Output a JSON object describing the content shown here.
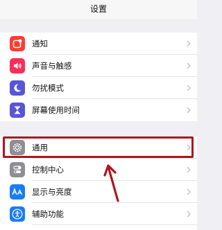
{
  "nav": {
    "title": "设置"
  },
  "group1": [
    {
      "label": "通知",
      "icon": "notifications-icon",
      "color": "#ff3b30"
    },
    {
      "label": "声音与触感",
      "icon": "sound-icon",
      "color": "#ff2d55"
    },
    {
      "label": "勿扰模式",
      "icon": "moon-icon",
      "color": "#5856d6"
    },
    {
      "label": "屏幕使用时间",
      "icon": "hourglass-icon",
      "color": "#5856d6"
    }
  ],
  "group2": [
    {
      "label": "通用",
      "icon": "gear-icon",
      "color": "#8e8e93"
    },
    {
      "label": "控制中心",
      "icon": "toggles-icon",
      "color": "#8e8e93"
    },
    {
      "label": "显示与亮度",
      "icon": "text-size-icon",
      "color": "#1a7cf5"
    },
    {
      "label": "辅助功能",
      "icon": "accessibility-icon",
      "color": "#1a7cf5"
    }
  ],
  "annotation": {
    "highlight_color": "#b0141c",
    "highlighted_item": "通用"
  }
}
